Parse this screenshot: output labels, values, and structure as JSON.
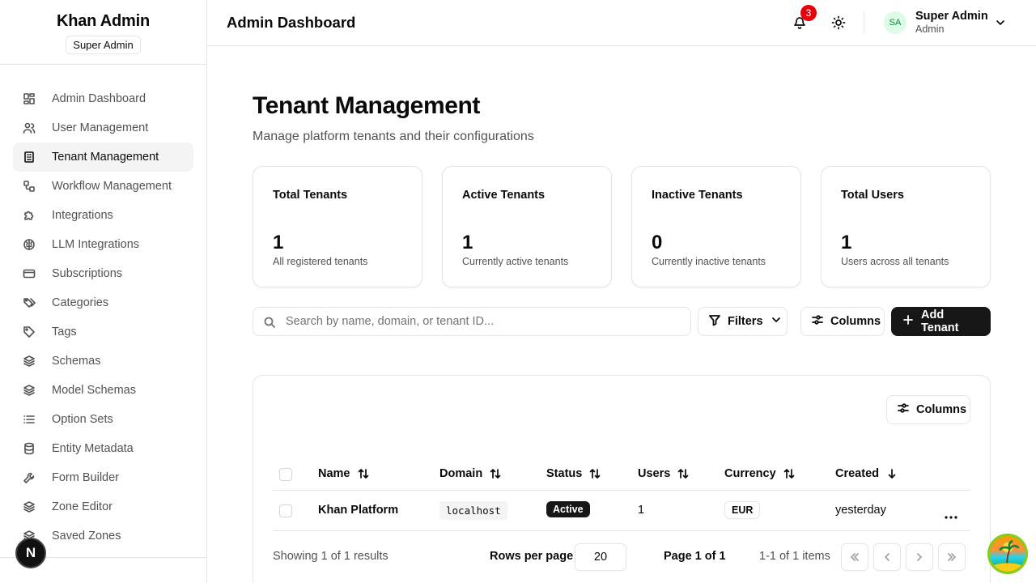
{
  "sidebar": {
    "brand": "Khan Admin",
    "role_badge": "Super Admin",
    "items": [
      {
        "label": "Admin Dashboard",
        "icon": "layout-dashboard-icon"
      },
      {
        "label": "User Management",
        "icon": "users-icon"
      },
      {
        "label": "Tenant Management",
        "icon": "building-icon",
        "active": true
      },
      {
        "label": "Workflow Management",
        "icon": "workflow-icon"
      },
      {
        "label": "Integrations",
        "icon": "puzzle-icon"
      },
      {
        "label": "LLM Integrations",
        "icon": "brain-icon"
      },
      {
        "label": "Subscriptions",
        "icon": "credit-card-icon"
      },
      {
        "label": "Categories",
        "icon": "tags-icon"
      },
      {
        "label": "Tags",
        "icon": "tag-icon"
      },
      {
        "label": "Schemas",
        "icon": "layers-icon"
      },
      {
        "label": "Model Schemas",
        "icon": "layers-icon"
      },
      {
        "label": "Option Sets",
        "icon": "list-icon"
      },
      {
        "label": "Entity Metadata",
        "icon": "database-icon"
      },
      {
        "label": "Form Builder",
        "icon": "wrench-icon"
      },
      {
        "label": "Zone Editor",
        "icon": "layers-icon"
      },
      {
        "label": "Saved Zones",
        "icon": "layers-icon"
      }
    ],
    "next_badge": "N"
  },
  "header": {
    "title": "Admin Dashboard",
    "notification_count": "3",
    "user": {
      "initials": "SA",
      "name": "Super Admin",
      "role": "Admin"
    }
  },
  "page": {
    "title": "Tenant Management",
    "subtitle": "Manage platform tenants and their configurations"
  },
  "stats": [
    {
      "label": "Total Tenants",
      "value": "1",
      "desc": "All registered tenants"
    },
    {
      "label": "Active Tenants",
      "value": "1",
      "desc": "Currently active tenants"
    },
    {
      "label": "Inactive Tenants",
      "value": "0",
      "desc": "Currently inactive tenants"
    },
    {
      "label": "Total Users",
      "value": "1",
      "desc": "Users across all tenants"
    }
  ],
  "toolbar": {
    "search_placeholder": "Search by name, domain, or tenant ID...",
    "filters": "Filters",
    "columns": "Columns",
    "add": "Add Tenant"
  },
  "table": {
    "columns_button": "Columns",
    "headers": {
      "name": "Name",
      "domain": "Domain",
      "status": "Status",
      "users": "Users",
      "currency": "Currency",
      "created": "Created"
    },
    "rows": [
      {
        "name": "Khan Platform",
        "domain": "localhost",
        "status": "Active",
        "users": "1",
        "currency": "EUR",
        "created": "yesterday"
      }
    ],
    "footer": {
      "showing": "Showing 1 of 1 results",
      "rows_per_page_label": "Rows per page",
      "rows_per_page": "20",
      "page_info": "Page 1 of 1",
      "range": "1-1 of 1 items"
    }
  },
  "colors": {
    "accent": "#171717",
    "notification": "#e7000b",
    "active_bg": "#f4f4f5"
  }
}
